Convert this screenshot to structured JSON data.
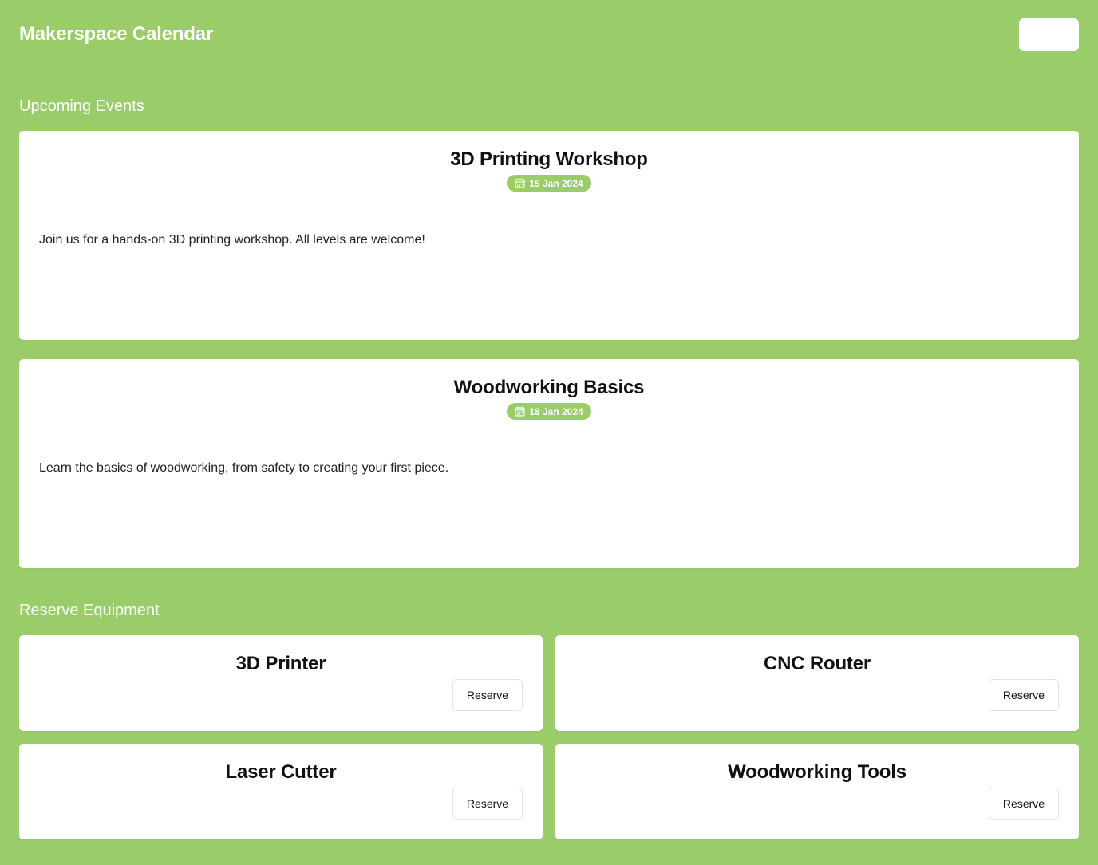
{
  "header": {
    "title": "Makerspace Calendar",
    "button_label": ""
  },
  "events_section": {
    "heading": "Upcoming Events",
    "events": [
      {
        "title": "3D Printing Workshop",
        "date": "15 Jan 2024",
        "date_icon": "calendar-icon",
        "description": "Join us for a hands-on 3D printing workshop. All levels are welcome!"
      },
      {
        "title": "Woodworking Basics",
        "date": "18 Jan 2024",
        "date_icon": "calendar-icon",
        "description": "Learn the basics of woodworking, from safety to creating your first piece."
      }
    ]
  },
  "equipment_section": {
    "heading": "Reserve Equipment",
    "items": [
      {
        "name": "3D Printer",
        "button_label": "Reserve"
      },
      {
        "name": "CNC Router",
        "button_label": "Reserve"
      },
      {
        "name": "Laser Cutter",
        "button_label": "Reserve"
      },
      {
        "name": "Woodworking Tools",
        "button_label": "Reserve"
      }
    ]
  },
  "colors": {
    "background": "#9acd6a",
    "card": "#ffffff",
    "badge": "#9acd6a",
    "text": "#111111"
  }
}
